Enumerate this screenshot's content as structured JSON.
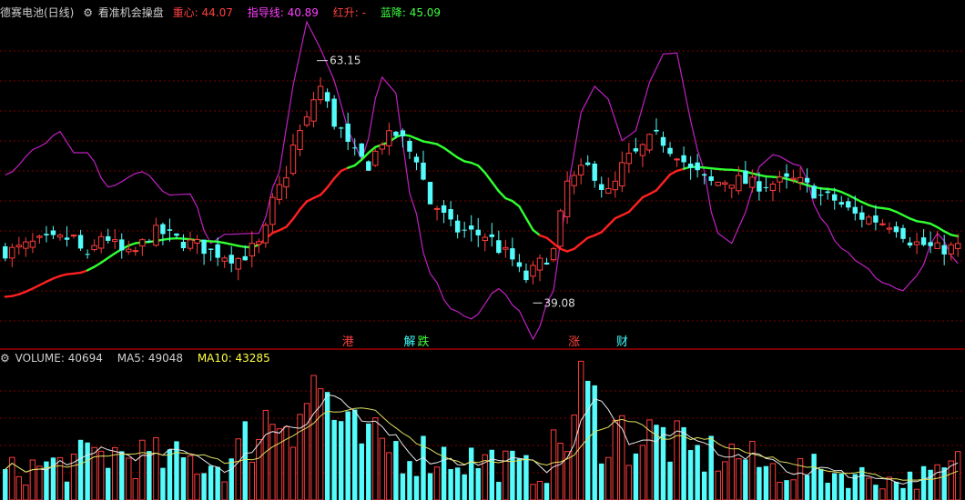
{
  "header": {
    "stock_name": "德赛电池(日线)",
    "indicator_name": "看准机会操盘",
    "items": [
      {
        "label": "重心:",
        "value": "44.07",
        "color": "#ff4040"
      },
      {
        "label": "指导线:",
        "value": "40.89",
        "color": "#ff40ff"
      },
      {
        "label": "红升:",
        "value": "-",
        "color": "#ff4040"
      },
      {
        "label": "蓝降:",
        "value": "45.09",
        "color": "#40ff40"
      }
    ]
  },
  "volume_header": {
    "title": "VOLUME:",
    "value": "40694",
    "ma5_label": "MA5:",
    "ma5_value": "49048",
    "ma10_label": "MA10:",
    "ma10_value": "43285"
  },
  "annotations": {
    "high_label": "63.15",
    "low_label": "39.08"
  },
  "event_markers": [
    {
      "text": "港",
      "color": "#ff4040",
      "bar": 50
    },
    {
      "text": "解",
      "color": "#40ffff",
      "bar": 59
    },
    {
      "text": "跌",
      "color": "#40ff40",
      "bar": 61
    },
    {
      "text": "涨",
      "color": "#ff4040",
      "bar": 83
    },
    {
      "text": "财",
      "color": "#40ffff",
      "bar": 90
    }
  ],
  "colors": {
    "up": "#ff3c3c",
    "down": "#54fcfc",
    "grid": "#7a0000",
    "guide": "#c020c0",
    "center_up": "#ff2020",
    "center_down": "#30ff30",
    "ma5": "#e8e8e8",
    "ma10": "#e0e060"
  },
  "chart_data": {
    "type": "candlestick",
    "bars": 140,
    "price_ylim": [
      34.5,
      67
    ],
    "volume_ylim": [
      0,
      150000
    ],
    "close_anchors": [
      [
        0,
        44.2
      ],
      [
        6,
        45.2
      ],
      [
        10,
        45.5
      ],
      [
        12,
        43.3
      ],
      [
        14,
        45.8
      ],
      [
        18,
        43.8
      ],
      [
        22,
        46.1
      ],
      [
        27,
        45.0
      ],
      [
        31,
        44.0
      ],
      [
        34,
        43.5
      ],
      [
        37,
        44.8
      ],
      [
        40,
        50.5
      ],
      [
        43,
        56.0
      ],
      [
        46,
        60.5
      ],
      [
        48,
        57.0
      ],
      [
        51,
        53.8
      ],
      [
        53,
        52.8
      ],
      [
        55,
        55.2
      ],
      [
        57,
        55.8
      ],
      [
        60,
        53.5
      ],
      [
        62,
        49.0
      ],
      [
        66,
        46.3
      ],
      [
        70,
        45.8
      ],
      [
        73,
        44.0
      ],
      [
        76,
        41.5
      ],
      [
        78,
        43.0
      ],
      [
        80,
        44.2
      ],
      [
        82,
        51.0
      ],
      [
        85,
        52.5
      ],
      [
        88,
        50.0
      ],
      [
        91,
        53.5
      ],
      [
        95,
        55.5
      ],
      [
        98,
        54.0
      ],
      [
        100,
        52.2
      ],
      [
        103,
        51.0
      ],
      [
        106,
        51.3
      ],
      [
        110,
        50.8
      ],
      [
        115,
        51.2
      ],
      [
        120,
        49.5
      ],
      [
        125,
        47.6
      ],
      [
        129,
        47.0
      ],
      [
        133,
        45.0
      ],
      [
        136,
        44.4
      ],
      [
        139,
        44.6
      ]
    ],
    "center_line_anchors": [
      [
        0,
        39.7
      ],
      [
        10,
        42.0
      ],
      [
        20,
        45.1
      ],
      [
        25,
        45.5
      ],
      [
        30,
        45.2
      ],
      [
        36,
        44.6
      ],
      [
        40,
        46.3
      ],
      [
        45,
        49.5
      ],
      [
        50,
        52.5
      ],
      [
        55,
        54.8
      ],
      [
        58,
        55.8
      ],
      [
        62,
        55.0
      ],
      [
        68,
        53.0
      ],
      [
        74,
        49.2
      ],
      [
        78,
        45.8
      ],
      [
        82,
        44.2
      ],
      [
        86,
        45.8
      ],
      [
        90,
        47.8
      ],
      [
        94,
        49.9
      ],
      [
        98,
        52.2
      ],
      [
        100,
        52.6
      ],
      [
        106,
        52.3
      ],
      [
        112,
        51.6
      ],
      [
        120,
        50.4
      ],
      [
        128,
        48.5
      ],
      [
        134,
        47.1
      ],
      [
        139,
        45.7
      ]
    ],
    "center_line_green_ranges": [
      [
        12,
        37
      ],
      [
        50,
        78
      ],
      [
        99,
        139
      ]
    ],
    "guide_line_anchors": [
      [
        0,
        51.8
      ],
      [
        5,
        54.6
      ],
      [
        8,
        56.1
      ],
      [
        10,
        54.0
      ],
      [
        12,
        54.0
      ],
      [
        15,
        50.6
      ],
      [
        20,
        52.1
      ],
      [
        24,
        49.8
      ],
      [
        27,
        49.9
      ],
      [
        30,
        45.0
      ],
      [
        32,
        45.9
      ],
      [
        37,
        46.0
      ],
      [
        40,
        52.1
      ],
      [
        42,
        60.7
      ],
      [
        44,
        67.0
      ],
      [
        46,
        64.3
      ],
      [
        48,
        61.2
      ],
      [
        50,
        56.3
      ],
      [
        52,
        53.3
      ],
      [
        55,
        61.5
      ],
      [
        57,
        59.9
      ],
      [
        59,
        50.0
      ],
      [
        62,
        42.0
      ],
      [
        65,
        38.5
      ],
      [
        68,
        37.5
      ],
      [
        72,
        40.5
      ],
      [
        75,
        38.3
      ],
      [
        77,
        35.5
      ],
      [
        80,
        40.3
      ],
      [
        82,
        50.0
      ],
      [
        84,
        58.0
      ],
      [
        86,
        60.6
      ],
      [
        88,
        59.3
      ],
      [
        90,
        55.2
      ],
      [
        92,
        56.2
      ],
      [
        94,
        61.0
      ],
      [
        96,
        63.8
      ],
      [
        98,
        63.9
      ],
      [
        100,
        57.2
      ],
      [
        101,
        54.3
      ],
      [
        104,
        46.0
      ],
      [
        106,
        45.0
      ],
      [
        108,
        48.1
      ],
      [
        110,
        52.6
      ],
      [
        112,
        53.8
      ],
      [
        116,
        52.7
      ],
      [
        119,
        47.5
      ],
      [
        122,
        44.5
      ],
      [
        125,
        42.9
      ],
      [
        128,
        41.1
      ],
      [
        131,
        40.3
      ],
      [
        133,
        41.8
      ],
      [
        136,
        46.0
      ],
      [
        139,
        43.0
      ]
    ],
    "volume_anchors": [
      [
        0,
        32000
      ],
      [
        8,
        40000
      ],
      [
        15,
        52000
      ],
      [
        25,
        45000
      ],
      [
        32,
        40000
      ],
      [
        38,
        90000
      ],
      [
        42,
        110000
      ],
      [
        46,
        125000
      ],
      [
        50,
        70000
      ],
      [
        55,
        60000
      ],
      [
        58,
        58000
      ],
      [
        62,
        52000
      ],
      [
        70,
        45000
      ],
      [
        78,
        32000
      ],
      [
        82,
        72000
      ],
      [
        84,
        115000
      ],
      [
        88,
        82000
      ],
      [
        92,
        68000
      ],
      [
        96,
        72000
      ],
      [
        100,
        50000
      ],
      [
        106,
        52000
      ],
      [
        112,
        35000
      ],
      [
        118,
        34000
      ],
      [
        124,
        28000
      ],
      [
        130,
        22000
      ],
      [
        136,
        28000
      ],
      [
        139,
        40000
      ]
    ],
    "high_marker": {
      "bar": 46,
      "price": 63.15
    },
    "low_marker": {
      "bar": 77,
      "price": 39.08
    }
  }
}
